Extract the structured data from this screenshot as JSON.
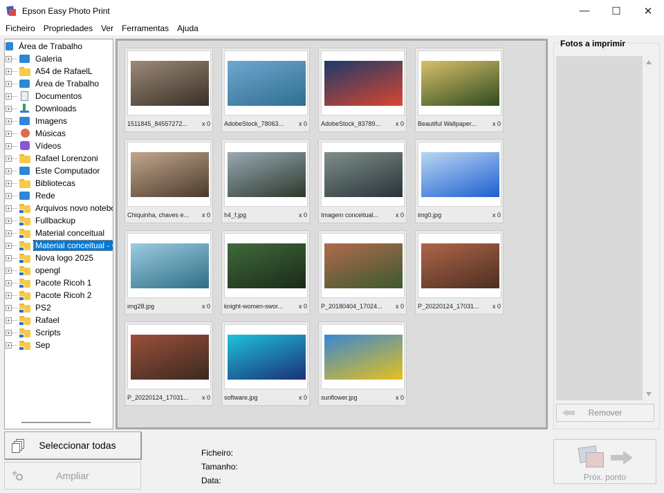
{
  "window": {
    "title": "Epson Easy Photo Print",
    "minimize": "—",
    "maximize": "☐",
    "close": "✕"
  },
  "menu": [
    "Ficheiro",
    "Propriedades",
    "Ver",
    "Ferramentas",
    "Ajuda"
  ],
  "tree": {
    "root": "Área de Trabalho",
    "items": [
      {
        "label": "Galeria",
        "icon": "gallery-icon"
      },
      {
        "label": "A54 de RafaelL",
        "icon": "folder-icon"
      },
      {
        "label": "Área de Trabalho",
        "icon": "desktop-icon"
      },
      {
        "label": "Documentos",
        "icon": "documents-icon"
      },
      {
        "label": "Downloads",
        "icon": "downloads-icon"
      },
      {
        "label": "Imagens",
        "icon": "images-icon"
      },
      {
        "label": "Músicas",
        "icon": "music-icon"
      },
      {
        "label": "Vídeos",
        "icon": "videos-icon"
      },
      {
        "label": "Rafael Lorenzoni",
        "icon": "folder-icon"
      },
      {
        "label": "Este Computador",
        "icon": "computer-icon"
      },
      {
        "label": "Bibliotecas",
        "icon": "folder-icon"
      },
      {
        "label": "Rede",
        "icon": "network-icon"
      },
      {
        "label": "Arquivos novo notebook",
        "icon": "folder-icon"
      },
      {
        "label": "Fullbackup",
        "icon": "folder-icon"
      },
      {
        "label": "Material conceitual",
        "icon": "folder-icon"
      },
      {
        "label": "Material conceitual - Copia",
        "icon": "folder-icon",
        "selected": true
      },
      {
        "label": "Nova logo 2025",
        "icon": "folder-icon"
      },
      {
        "label": "opengl",
        "icon": "folder-icon"
      },
      {
        "label": "Pacote Ricoh 1",
        "icon": "folder-icon"
      },
      {
        "label": "Pacote Ricoh 2",
        "icon": "folder-icon"
      },
      {
        "label": "PS2",
        "icon": "folder-icon"
      },
      {
        "label": "Rafael",
        "icon": "folder-icon"
      },
      {
        "label": "Scripts",
        "icon": "folder-icon"
      },
      {
        "label": "Sep",
        "icon": "folder-icon"
      }
    ]
  },
  "thumbnails": [
    {
      "caption": "1511845_84557272...",
      "count": "x 0",
      "colors": [
        "#9b8a78",
        "#3a2f26"
      ]
    },
    {
      "caption": "AdobeStock_78063...",
      "count": "x 0",
      "colors": [
        "#6fa7d0",
        "#2f6e8f"
      ]
    },
    {
      "caption": "AdobeStock_83789...",
      "count": "x 0",
      "colors": [
        "#1c3a6a",
        "#d9462f"
      ]
    },
    {
      "caption": "Beautiful Wallpaper...",
      "count": "x 0",
      "colors": [
        "#d7c16a",
        "#2f4a1f"
      ]
    },
    {
      "caption": "Chiquinha, chaves e...",
      "count": "x 0",
      "colors": [
        "#c2a78d",
        "#4a3a2c"
      ]
    },
    {
      "caption": "h4_f.jpg",
      "count": "x 0",
      "colors": [
        "#9aa8b4",
        "#2b3a2b"
      ]
    },
    {
      "caption": "Imagem conceitual...",
      "count": "x 0",
      "colors": [
        "#7f8e8a",
        "#28343a"
      ]
    },
    {
      "caption": "img0.jpg",
      "count": "x 0",
      "colors": [
        "#b9d7f2",
        "#1e5fd1"
      ]
    },
    {
      "caption": "img28.jpg",
      "count": "x 0",
      "colors": [
        "#9ccbe0",
        "#2e6e86"
      ]
    },
    {
      "caption": "knight-women-swor...",
      "count": "x 0",
      "colors": [
        "#3f6a3a",
        "#1b2a1a"
      ]
    },
    {
      "caption": "P_20180404_17024...",
      "count": "x 0",
      "colors": [
        "#b06a4e",
        "#3c5a2e"
      ]
    },
    {
      "caption": "P_20220124_17031...",
      "count": "x 0",
      "colors": [
        "#b06548",
        "#4a2f22"
      ]
    },
    {
      "caption": "P_20220124_17031...",
      "count": "x 0",
      "colors": [
        "#9a4f3a",
        "#3a2a20"
      ]
    },
    {
      "caption": "software.jpg",
      "count": "x 0",
      "colors": [
        "#1ec2d8",
        "#1b2f7a"
      ]
    },
    {
      "caption": "sunflower.jpg",
      "count": "x 0",
      "colors": [
        "#3a86d2",
        "#e6c11c"
      ]
    }
  ],
  "fotos_panel": {
    "title": "Fotos a imprimir",
    "remove_label": "Remover"
  },
  "bottom": {
    "select_all": "Seleccionar todas",
    "zoom": "Ampliar",
    "file_label": "Ficheiro:",
    "size_label": "Tamanho:",
    "date_label": "Data:",
    "next_label": "Próx. ponto"
  }
}
